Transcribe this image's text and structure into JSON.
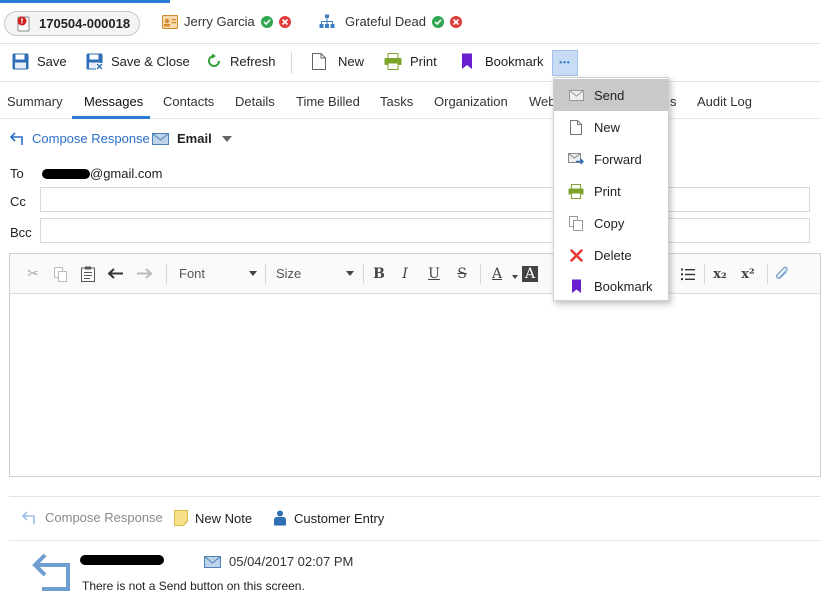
{
  "topbar": {
    "case_number": "170504-000018",
    "contact_name": "Jerry Garcia",
    "organization_name": "Grateful Dead"
  },
  "toolbar": {
    "save_label": "Save",
    "save_close_label": "Save & Close",
    "refresh_label": "Refresh",
    "new_label": "New",
    "print_label": "Print",
    "bookmark_label": "Bookmark",
    "more_label": "•••"
  },
  "nav_tabs": [
    {
      "label": "Summary"
    },
    {
      "label": "Messages"
    },
    {
      "label": "Contacts"
    },
    {
      "label": "Details"
    },
    {
      "label": "Time Billed"
    },
    {
      "label": "Tasks"
    },
    {
      "label": "Organization"
    },
    {
      "label": "Web"
    },
    {
      "label": "s"
    },
    {
      "label": "Audit Log"
    }
  ],
  "compose": {
    "compose_response_label": "Compose Response",
    "channel_label": "Email",
    "to_label": "To",
    "to_value_suffix": "@gmail.com",
    "cc_label": "Cc",
    "bcc_label": "Bcc",
    "cc_value": "",
    "bcc_value": ""
  },
  "editor": {
    "font_label": "Font",
    "size_label": "Size",
    "bold": "B",
    "italic": "I",
    "underline": "U",
    "strike": "S",
    "font_color": "A",
    "bg_color": "A",
    "subscript": "x₂",
    "superscript": "x²"
  },
  "menu": {
    "items": [
      {
        "label": "Send",
        "icon": "envelope-icon"
      },
      {
        "label": "New",
        "icon": "document-icon"
      },
      {
        "label": "Forward",
        "icon": "forward-icon"
      },
      {
        "label": "Print",
        "icon": "printer-icon"
      },
      {
        "label": "Copy",
        "icon": "copy-icon"
      },
      {
        "label": "Delete",
        "icon": "delete-icon"
      },
      {
        "label": "Bookmark",
        "icon": "bookmark-icon"
      }
    ]
  },
  "bottom_actions": {
    "compose_response_label": "Compose Response",
    "new_note_label": "New Note",
    "customer_entry_label": "Customer Entry"
  },
  "thread": {
    "timestamp": "05/04/2017 02:07 PM",
    "message": "There is not a Send button on this screen."
  },
  "colors": {
    "accent": "#2b7cd3",
    "link": "#2b6fc7",
    "success": "#2fa84f",
    "danger": "#e23b3b",
    "bookmark": "#6a1fcf",
    "print": "#7da32b"
  }
}
